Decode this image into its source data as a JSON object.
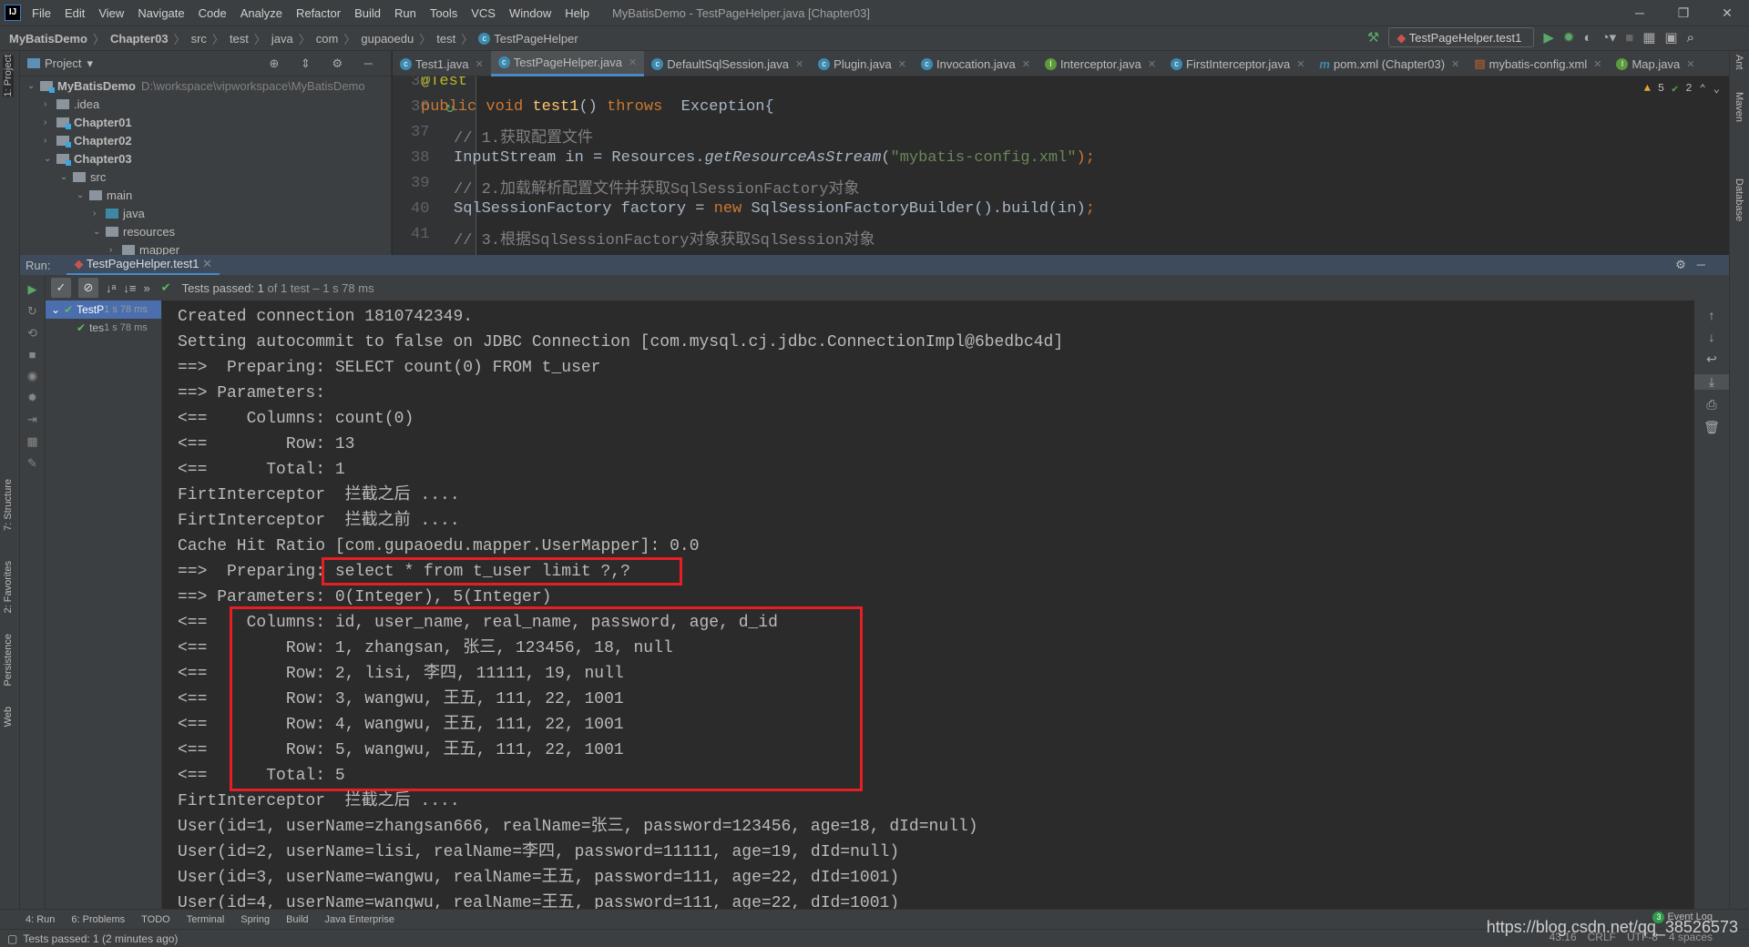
{
  "window": {
    "title": "MyBatisDemo - TestPageHelper.java [Chapter03]",
    "logo": "IJ",
    "controls": [
      "minimize",
      "restore",
      "close"
    ]
  },
  "menu": [
    "File",
    "Edit",
    "View",
    "Navigate",
    "Code",
    "Analyze",
    "Refactor",
    "Build",
    "Run",
    "Tools",
    "VCS",
    "Window",
    "Help"
  ],
  "breadcrumb": [
    "MyBatisDemo",
    "Chapter03",
    "src",
    "test",
    "java",
    "com",
    "gupaoedu",
    "test",
    "TestPageHelper"
  ],
  "run_config": {
    "selected": "TestPageHelper.test1"
  },
  "left_strip": {
    "items": [
      "1: Project",
      "7: Structure",
      "2: Favorites",
      "Persistence",
      "Web"
    ]
  },
  "right_strip": {
    "items": [
      "Ant",
      "Maven",
      "Database"
    ]
  },
  "project": {
    "header": "Project",
    "tree": [
      {
        "label": "MyBatisDemo",
        "path": "D:\\workspace\\vipworkspace\\MyBatisDemo",
        "depth": 0,
        "open": true,
        "bold": true,
        "type": "mod"
      },
      {
        "label": ".idea",
        "depth": 1,
        "open": false,
        "type": "folder"
      },
      {
        "label": "Chapter01",
        "depth": 1,
        "open": false,
        "bold": true,
        "type": "mod"
      },
      {
        "label": "Chapter02",
        "depth": 1,
        "open": false,
        "bold": true,
        "type": "mod"
      },
      {
        "label": "Chapter03",
        "depth": 1,
        "open": true,
        "bold": true,
        "type": "mod"
      },
      {
        "label": "src",
        "depth": 2,
        "open": true,
        "type": "folder"
      },
      {
        "label": "main",
        "depth": 3,
        "open": true,
        "type": "folder"
      },
      {
        "label": "java",
        "depth": 4,
        "open": false,
        "type": "src"
      },
      {
        "label": "resources",
        "depth": 4,
        "open": true,
        "type": "folder"
      },
      {
        "label": "mapper",
        "depth": 5,
        "open": false,
        "type": "folder"
      }
    ]
  },
  "editor_tabs": [
    {
      "label": "Test1.java",
      "icon": "c"
    },
    {
      "label": "TestPageHelper.java",
      "icon": "c",
      "active": true
    },
    {
      "label": "DefaultSqlSession.java",
      "icon": "c"
    },
    {
      "label": "Plugin.java",
      "icon": "c"
    },
    {
      "label": "Invocation.java",
      "icon": "c"
    },
    {
      "label": "Interceptor.java",
      "icon": "i"
    },
    {
      "label": "FirstInterceptor.java",
      "icon": "c"
    },
    {
      "label": "pom.xml (Chapter03)",
      "icon": "m"
    },
    {
      "label": "mybatis-config.xml",
      "icon": "xml"
    },
    {
      "label": "Map.java",
      "icon": "i"
    }
  ],
  "inspections": {
    "warnings": "5",
    "ok": "2"
  },
  "code": [
    {
      "n": "35",
      "t": [
        [
          "@Test",
          "an"
        ]
      ],
      "indent": 0
    },
    {
      "n": "36",
      "t": [
        [
          "public ",
          "kw"
        ],
        [
          "void ",
          "kw"
        ],
        [
          "test1",
          "fn"
        ],
        [
          "() ",
          ""
        ],
        [
          "throws ",
          "kw"
        ],
        [
          " Exception{",
          ""
        ]
      ],
      "indent": 0
    },
    {
      "n": "37",
      "t": [
        [
          "// 1.获取配置文件",
          "cm"
        ]
      ],
      "indent": 1
    },
    {
      "n": "38",
      "t": [
        [
          "InputStream in = Resources.",
          ""
        ],
        [
          "getResourceAsStream",
          "it"
        ],
        [
          "(",
          ""
        ],
        [
          "\"mybatis-config.xml\"",
          "st"
        ],
        [
          ");",
          "kw"
        ]
      ],
      "indent": 1
    },
    {
      "n": "39",
      "t": [
        [
          "// 2.加载解析配置文件并获取SqlSessionFactory对象",
          "cm"
        ]
      ],
      "indent": 1
    },
    {
      "n": "40",
      "t": [
        [
          "SqlSessionFactory factory = ",
          ""
        ],
        [
          "new ",
          "kw"
        ],
        [
          "SqlSessionFactoryBuilder().build(in)",
          ""
        ],
        [
          ";",
          "kw"
        ]
      ],
      "indent": 1
    },
    {
      "n": "41",
      "t": [
        [
          "// 3.根据SqlSessionFactory对象获取SqlSession对象",
          "cm"
        ]
      ],
      "indent": 1
    }
  ],
  "run": {
    "label": "Run:",
    "tab": "TestPageHelper.test1",
    "status_bold": "Tests passed: 1",
    "status_rest": " of 1 test – 1 s 78 ms",
    "tests": [
      {
        "label": "TestP",
        "time": "1 s 78 ms",
        "selected": true
      },
      {
        "label": "tes",
        "time": "1 s 78 ms"
      }
    ]
  },
  "console": {
    "lines": [
      "Created connection 1810742349.",
      "Setting autocommit to false on JDBC Connection [com.mysql.cj.jdbc.ConnectionImpl@6bedbc4d]",
      "==>  Preparing: SELECT count(0) FROM t_user",
      "==> Parameters: ",
      "<==    Columns: count(0)",
      "<==        Row: 13",
      "<==      Total: 1",
      "FirtInterceptor  拦截之后 ....",
      "FirtInterceptor  拦截之前 ....",
      "Cache Hit Ratio [com.gupaoedu.mapper.UserMapper]: 0.0",
      "==>  Preparing: select * from t_user limit ?,?",
      "==> Parameters: 0(Integer), 5(Integer)",
      "<==    Columns: id, user_name, real_name, password, age, d_id",
      "<==        Row: 1, zhangsan, 张三, 123456, 18, null",
      "<==        Row: 2, lisi, 李四, 11111, 19, null",
      "<==        Row: 3, wangwu, 王五, 111, 22, 1001",
      "<==        Row: 4, wangwu, 王五, 111, 22, 1001",
      "<==        Row: 5, wangwu, 王五, 111, 22, 1001",
      "<==      Total: 5",
      "FirtInterceptor  拦截之后 ....",
      "User(id=1, userName=zhangsan666, realName=张三, password=123456, age=18, dId=null)",
      "User(id=2, userName=lisi, realName=李四, password=11111, age=19, dId=null)",
      "User(id=3, userName=wangwu, realName=王五, password=111, age=22, dId=1001)",
      "User(id=4, userName=wangwu, realName=王五, password=111, age=22, dId=1001)"
    ],
    "highlight_color": "#e81e25"
  },
  "bottom_tools": [
    "4: Run",
    "6: Problems",
    "TODO",
    "Terminal",
    "Spring",
    "Build",
    "Java Enterprise"
  ],
  "event_log": {
    "count": "3",
    "label": "Event Log"
  },
  "status": {
    "message": "Tests passed: 1 (2 minutes ago)",
    "position": "43:16",
    "line_sep": "CRLF",
    "encoding": "UTF-8",
    "indent": "4 spaces"
  },
  "watermark": "https://blog.csdn.net/qq_38526573"
}
